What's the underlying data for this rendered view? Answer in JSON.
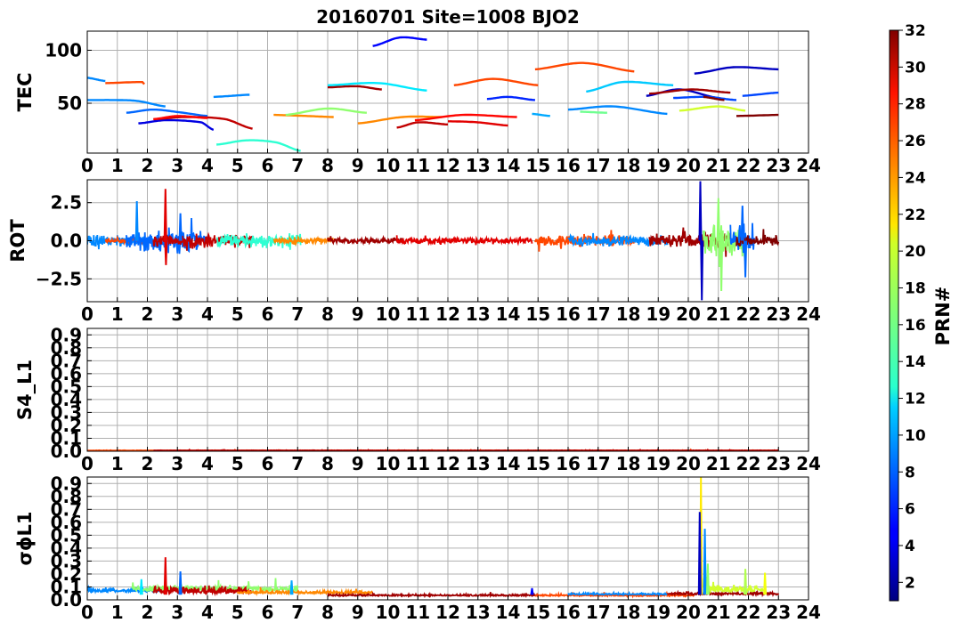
{
  "chart_data": {
    "type": "line",
    "title": "20160701 Site=1008 BJO2",
    "x_ticks": [
      "0",
      "1",
      "2",
      "3",
      "4",
      "5",
      "6",
      "7",
      "8",
      "9",
      "10",
      "11",
      "12",
      "13",
      "14",
      "15",
      "16",
      "17",
      "18",
      "19",
      "20",
      "21",
      "22",
      "23",
      "24"
    ],
    "xlim": [
      0,
      24
    ],
    "colorbar": {
      "label": "PRN#",
      "range": [
        1,
        32
      ],
      "ticks": [
        "2",
        "4",
        "6",
        "8",
        "10",
        "12",
        "14",
        "16",
        "18",
        "20",
        "22",
        "24",
        "26",
        "28",
        "30",
        "32"
      ]
    },
    "panels": [
      {
        "id": "tec",
        "ylabel": "TEC",
        "ylim": [
          3,
          118
        ],
        "y_ticks": [
          {
            "v": 50,
            "t": "50"
          },
          {
            "v": 100,
            "t": "100"
          }
        ],
        "segments": [
          {
            "prn": 9,
            "x": [
              0,
              0.6
            ],
            "y": [
              74,
              71
            ]
          },
          {
            "prn": 26,
            "x": [
              0.6,
              1.9
            ],
            "y": [
              69,
              70,
              68
            ]
          },
          {
            "prn": 9,
            "x": [
              0,
              1.0,
              1.7,
              2.6
            ],
            "y": [
              53,
              53,
              52,
              47
            ]
          },
          {
            "prn": 8,
            "x": [
              1.3,
              2.2,
              3.2,
              4.0
            ],
            "y": [
              41,
              44,
              41,
              38
            ]
          },
          {
            "prn": 4,
            "x": [
              1.7,
              2.6,
              3.8,
              4.2
            ],
            "y": [
              31,
              34,
              32,
              25
            ]
          },
          {
            "prn": 30,
            "x": [
              2.2,
              3.3,
              4.6,
              5.5
            ],
            "y": [
              35,
              37,
              35,
              26
            ]
          },
          {
            "prn": 28,
            "x": [
              2.2,
              3.0,
              4.0
            ],
            "y": [
              35,
              38,
              36
            ]
          },
          {
            "prn": 9,
            "x": [
              4.2,
              5.4
            ],
            "y": [
              56,
              58
            ]
          },
          {
            "prn": 14,
            "x": [
              4.3,
              5.3,
              6.3,
              7.1
            ],
            "y": [
              11,
              15,
              13,
              5
            ]
          },
          {
            "prn": 24,
            "x": [
              6.2,
              7.3,
              8.2
            ],
            "y": [
              39,
              38,
              37
            ]
          },
          {
            "prn": 17,
            "x": [
              6.6,
              8.0,
              9.3
            ],
            "y": [
              39,
              45,
              41
            ]
          },
          {
            "prn": 31,
            "x": [
              8.0,
              9.0,
              9.8
            ],
            "y": [
              65,
              66,
              63
            ]
          },
          {
            "prn": 12,
            "x": [
              8.0,
              9.7,
              11.3
            ],
            "y": [
              67,
              69,
              62
            ]
          },
          {
            "prn": 24,
            "x": [
              9.0,
              10.5,
              11.8
            ],
            "y": [
              31,
              37,
              37
            ]
          },
          {
            "prn": 5,
            "x": [
              9.5,
              10.4,
              11.3
            ],
            "y": [
              104,
              112,
              110
            ]
          },
          {
            "prn": 30,
            "x": [
              10.3,
              11.0,
              12.0
            ],
            "y": [
              27,
              32,
              30
            ]
          },
          {
            "prn": 28,
            "x": [
              10.9,
              12.5,
              14.3
            ],
            "y": [
              34,
              39,
              37
            ]
          },
          {
            "prn": 29,
            "x": [
              12.0,
              13.0,
              14.0
            ],
            "y": [
              33,
              32,
              29
            ]
          },
          {
            "prn": 26,
            "x": [
              12.2,
              13.5,
              15.0
            ],
            "y": [
              67,
              73,
              67
            ]
          },
          {
            "prn": 6,
            "x": [
              13.3,
              14.0,
              14.9
            ],
            "y": [
              54,
              56,
              53
            ]
          },
          {
            "prn": 10,
            "x": [
              14.8,
              15.4
            ],
            "y": [
              40,
              38
            ]
          },
          {
            "prn": 26,
            "x": [
              14.9,
              16.5,
              18.2
            ],
            "y": [
              82,
              88,
              80
            ]
          },
          {
            "prn": 9,
            "x": [
              16.0,
              17.5,
              19.3
            ],
            "y": [
              44,
              47,
              40
            ]
          },
          {
            "prn": 16,
            "x": [
              16.4,
              17.3
            ],
            "y": [
              42,
              41
            ]
          },
          {
            "prn": 11,
            "x": [
              16.6,
              17.8,
              19.5
            ],
            "y": [
              61,
              70,
              67
            ]
          },
          {
            "prn": 3,
            "x": [
              18.6,
              19.7,
              21.0
            ],
            "y": [
              57,
              63,
              55
            ]
          },
          {
            "prn": 31,
            "x": [
              18.7,
              20.1,
              21.4
            ],
            "y": [
              59,
              63,
              60
            ]
          },
          {
            "prn": 7,
            "x": [
              19.5,
              20.6,
              21.6
            ],
            "y": [
              55,
              56,
              53
            ]
          },
          {
            "prn": 19,
            "x": [
              19.7,
              21.0,
              21.9
            ],
            "y": [
              43,
              47,
              43
            ]
          },
          {
            "prn": 3,
            "x": [
              20.2,
              21.5,
              23.0
            ],
            "y": [
              78,
              84,
              82
            ]
          },
          {
            "prn": 32,
            "x": [
              20.5,
              21.2
            ],
            "y": [
              56,
              53
            ]
          },
          {
            "prn": 32,
            "x": [
              21.6,
              23.0
            ],
            "y": [
              38,
              39
            ]
          },
          {
            "prn": 7,
            "x": [
              21.8,
              23.0
            ],
            "y": [
              57,
              60
            ]
          }
        ]
      },
      {
        "id": "rot",
        "ylabel": "ROT",
        "ylim": [
          -4,
          4
        ],
        "y_ticks": [
          {
            "v": 2.5,
            "t": "2.5"
          },
          {
            "v": 0,
            "t": "0.0"
          },
          {
            "v": -2.5,
            "t": "−2.5"
          }
        ],
        "noise_series": [
          {
            "prn": 9,
            "x0": 0,
            "x1": 2.4,
            "amp": 0.45,
            "seed": 3
          },
          {
            "prn": 26,
            "x0": 0.6,
            "x1": 2.0,
            "amp": 0.2,
            "seed": 7
          },
          {
            "prn": 8,
            "x0": 1.3,
            "x1": 4.0,
            "amp": 0.9,
            "seed": 11
          },
          {
            "prn": 30,
            "x0": 2.2,
            "x1": 5.5,
            "amp": 0.5,
            "seed": 13
          },
          {
            "prn": 14,
            "x0": 4.3,
            "x1": 7.1,
            "amp": 0.55,
            "seed": 17
          },
          {
            "prn": 24,
            "x0": 6.2,
            "x1": 8.2,
            "amp": 0.25,
            "seed": 19
          },
          {
            "prn": 31,
            "x0": 8.0,
            "x1": 10.5,
            "amp": 0.25,
            "seed": 23
          },
          {
            "prn": 29,
            "x0": 10.3,
            "x1": 14.8,
            "amp": 0.25,
            "seed": 29
          },
          {
            "prn": 26,
            "x0": 14.9,
            "x1": 18.2,
            "amp": 0.4,
            "seed": 31
          },
          {
            "prn": 9,
            "x0": 16.0,
            "x1": 19.3,
            "amp": 0.4,
            "seed": 37
          },
          {
            "prn": 31,
            "x0": 18.7,
            "x1": 21.4,
            "amp": 0.6,
            "seed": 41
          },
          {
            "prn": 17,
            "x0": 20.5,
            "x1": 21.9,
            "amp": 1.2,
            "seed": 43
          },
          {
            "prn": 8,
            "x0": 21.4,
            "x1": 22.2,
            "amp": 1.1,
            "seed": 47
          },
          {
            "prn": 32,
            "x0": 21.6,
            "x1": 23.0,
            "amp": 0.45,
            "seed": 53
          }
        ],
        "spikes": [
          {
            "prn": 9,
            "x": 1.65,
            "y": 2.6
          },
          {
            "prn": 29,
            "x": 2.6,
            "y": 3.4
          },
          {
            "prn": 29,
            "x": 2.62,
            "y": -1.6
          },
          {
            "prn": 8,
            "x": 3.1,
            "y": 1.8
          },
          {
            "prn": 3,
            "x": 20.4,
            "y": 3.9
          },
          {
            "prn": 3,
            "x": 20.45,
            "y": -3.9
          },
          {
            "prn": 17,
            "x": 21.0,
            "y": 2.8
          },
          {
            "prn": 17,
            "x": 21.1,
            "y": -3.3
          },
          {
            "prn": 8,
            "x": 21.8,
            "y": 2.3
          },
          {
            "prn": 8,
            "x": 21.9,
            "y": -2.4
          }
        ]
      },
      {
        "id": "s4",
        "ylabel": "S4_L1",
        "ylim": [
          0,
          0.95
        ],
        "y_ticks": [
          {
            "v": 0.0,
            "t": "0.0"
          },
          {
            "v": 0.1,
            "t": "0.1"
          },
          {
            "v": 0.2,
            "t": "0.2"
          },
          {
            "v": 0.3,
            "t": "0.3"
          },
          {
            "v": 0.4,
            "t": "0.4"
          },
          {
            "v": 0.5,
            "t": "0.5"
          },
          {
            "v": 0.6,
            "t": "0.6"
          },
          {
            "v": 0.7,
            "t": "0.7"
          },
          {
            "v": 0.8,
            "t": "0.8"
          },
          {
            "v": 0.9,
            "t": "0.9"
          }
        ],
        "noise_series": [
          {
            "prn": 26,
            "x0": 0,
            "x1": 23,
            "amp": 0.004,
            "base": 0.005,
            "seed": 61
          },
          {
            "prn": 30,
            "x0": 2.2,
            "x1": 23,
            "amp": 0.004,
            "base": 0.005,
            "seed": 67
          }
        ],
        "spikes": []
      },
      {
        "id": "sigma",
        "ylabel": "σϕL1",
        "ylim": [
          0,
          0.95
        ],
        "y_ticks": [
          {
            "v": 0.0,
            "t": "0.0"
          },
          {
            "v": 0.1,
            "t": "0.1"
          },
          {
            "v": 0.2,
            "t": "0.2"
          },
          {
            "v": 0.3,
            "t": "0.3"
          },
          {
            "v": 0.4,
            "t": "0.4"
          },
          {
            "v": 0.5,
            "t": "0.5"
          },
          {
            "v": 0.6,
            "t": "0.6"
          },
          {
            "v": 0.7,
            "t": "0.7"
          },
          {
            "v": 0.8,
            "t": "0.8"
          },
          {
            "v": 0.9,
            "t": "0.9"
          }
        ],
        "noise_series": [
          {
            "prn": 9,
            "x0": 0,
            "x1": 2.4,
            "amp": 0.05,
            "base": 0.06,
            "seed": 71
          },
          {
            "prn": 17,
            "x0": 1.5,
            "x1": 7.0,
            "amp": 0.06,
            "base": 0.07,
            "seed": 73
          },
          {
            "prn": 30,
            "x0": 2.2,
            "x1": 5.5,
            "amp": 0.08,
            "base": 0.05,
            "seed": 79
          },
          {
            "prn": 24,
            "x0": 5.0,
            "x1": 9.5,
            "amp": 0.03,
            "base": 0.05,
            "seed": 83
          },
          {
            "prn": 31,
            "x0": 8.0,
            "x1": 15.0,
            "amp": 0.02,
            "base": 0.03,
            "seed": 89
          },
          {
            "prn": 26,
            "x0": 14.9,
            "x1": 20.2,
            "amp": 0.02,
            "base": 0.03,
            "seed": 97
          },
          {
            "prn": 9,
            "x0": 16.0,
            "x1": 19.3,
            "amp": 0.02,
            "base": 0.04,
            "seed": 101
          },
          {
            "prn": 31,
            "x0": 19.3,
            "x1": 23.0,
            "amp": 0.03,
            "base": 0.04,
            "seed": 103
          },
          {
            "prn": 19,
            "x0": 20.5,
            "x1": 22.5,
            "amp": 0.08,
            "base": 0.06,
            "seed": 107
          }
        ],
        "spikes": [
          {
            "prn": 12,
            "x": 1.8,
            "y": 0.16
          },
          {
            "prn": 29,
            "x": 2.6,
            "y": 0.33
          },
          {
            "prn": 8,
            "x": 3.1,
            "y": 0.22
          },
          {
            "prn": 10,
            "x": 6.8,
            "y": 0.15
          },
          {
            "prn": 21,
            "x": 20.42,
            "y": 0.95
          },
          {
            "prn": 3,
            "x": 20.38,
            "y": 0.68
          },
          {
            "prn": 9,
            "x": 20.55,
            "y": 0.55
          },
          {
            "prn": 17,
            "x": 20.65,
            "y": 0.28
          },
          {
            "prn": 18,
            "x": 21.9,
            "y": 0.24
          },
          {
            "prn": 20,
            "x": 22.55,
            "y": 0.21
          },
          {
            "prn": 5,
            "x": 14.8,
            "y": 0.09
          }
        ]
      }
    ]
  }
}
